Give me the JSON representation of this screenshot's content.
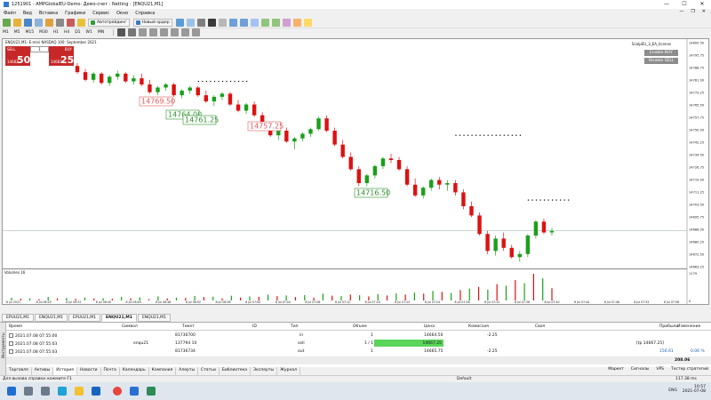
{
  "window": {
    "title": "1251901 - AMPGlobalEU-Demo: Демо-счет - Netting - [ENQU21,M1]",
    "controls": [
      "—",
      "☐",
      "✕"
    ]
  },
  "menu": [
    "Файл",
    "Вид",
    "Вставка",
    "Графики",
    "Сервис",
    "Окно",
    "Справка"
  ],
  "menu_mdi": [
    "—",
    "❐",
    "✕"
  ],
  "toolbar": {
    "autotrading_label": "Автотрейдинг",
    "new_order_label": "Новый ордер"
  },
  "timeframes": [
    "M1",
    "M5",
    "M15",
    "M30",
    "H1",
    "H4",
    "D1",
    "W1",
    "MN"
  ],
  "active_timeframe": "M1",
  "chart": {
    "symbol_header": "ENQU21,M1: E-mini NASDAQ 100: September 2021",
    "one_click": {
      "sell_label": "SELL",
      "buy_label": "BUY",
      "lot": "1",
      "sell_price_small": "14682",
      "sell_price_big": "50",
      "buy_price_small": "14683",
      "buy_price_big": "25"
    },
    "ea": {
      "name": "ScalpEU_3_EA_license",
      "enable_buy": "Enable BUY",
      "disable_sell": "Disable SELL"
    },
    "trade_labels": [
      {
        "text": "14769.50",
        "kind": "sell"
      },
      {
        "text": "14764.00",
        "kind": "buy"
      },
      {
        "text": "14761.25",
        "kind": "buy"
      },
      {
        "text": "14757.25",
        "kind": "sell"
      },
      {
        "text": "14716.50",
        "kind": "buy"
      }
    ],
    "volume_label": "Volumes 16",
    "volume_axis_top": "1179",
    "volume_axis_bottom": "0",
    "colors": {
      "up": "#1aa01a",
      "down": "#dd1111",
      "dots": "#000000"
    }
  },
  "chart_data": {
    "type": "candlestick",
    "series_name": "ENQU21",
    "ylim": [
      14663.25,
      14800.5
    ],
    "y_ticks": [
      "14800.50",
      "14795.75",
      "14788.75",
      "14781.00",
      "14773.25",
      "14765.50",
      "14757.75",
      "14750.00",
      "14742.25",
      "14734.50",
      "14726.75",
      "14719.00",
      "14711.25",
      "14703.50",
      "14695.75",
      "14688.00",
      "14680.25",
      "14672.50",
      "14663.25"
    ],
    "x_ticks": [
      "8 Jul 2021",
      "8 Jul 06:29",
      "8 Jul 06:32",
      "8 Jul 06:40",
      "8 Jul 06:46",
      "8 Jul 06:48",
      "8 Jul 06:52",
      "8 Jul 06:56",
      "8 Jul 07:00",
      "8 Jul 07:04",
      "8 Jul 07:08",
      "8 Jul 07:12",
      "8 Jul 07:16",
      "8 Jul 07:20",
      "8 Jul 07:24",
      "8 Jul 07:28",
      "8 Jul 07:32",
      "8 Jul 07:36",
      "8 Jul 07:40",
      "8 Jul 07:44",
      "8 Jul 07:48",
      "8 Jul 07:52",
      "8 Jul 07:56"
    ],
    "ohlc": [
      [
        14790,
        14792,
        14785,
        14786
      ],
      [
        14786,
        14788,
        14780,
        14781
      ],
      [
        14781,
        14786,
        14779,
        14785
      ],
      [
        14785,
        14786,
        14778,
        14779
      ],
      [
        14779,
        14784,
        14777,
        14783
      ],
      [
        14783,
        14787,
        14781,
        14785
      ],
      [
        14785,
        14786,
        14779,
        14780
      ],
      [
        14780,
        14784,
        14778,
        14782
      ],
      [
        14782,
        14785,
        14777,
        14778
      ],
      [
        14778,
        14781,
        14772,
        14773
      ],
      [
        14773,
        14777,
        14771,
        14776
      ],
      [
        14776,
        14779,
        14774,
        14778
      ],
      [
        14778,
        14779,
        14770,
        14771
      ],
      [
        14771,
        14775,
        14769,
        14774
      ],
      [
        14774,
        14777,
        14772,
        14776
      ],
      [
        14776,
        14777,
        14770,
        14771
      ],
      [
        14771,
        14774,
        14766,
        14767
      ],
      [
        14767,
        14771,
        14764,
        14770
      ],
      [
        14770,
        14773,
        14768,
        14772
      ],
      [
        14772,
        14773,
        14764,
        14765
      ],
      [
        14765,
        14768,
        14760,
        14761
      ],
      [
        14761,
        14766,
        14759,
        14765
      ],
      [
        14765,
        14767,
        14757,
        14758
      ],
      [
        14758,
        14760,
        14750,
        14751
      ],
      [
        14751,
        14753,
        14744,
        14745
      ],
      [
        14745,
        14749,
        14742,
        14748
      ],
      [
        14748,
        14750,
        14740,
        14741
      ],
      [
        14741,
        14744,
        14736,
        14743
      ],
      [
        14743,
        14747,
        14741,
        14746
      ],
      [
        14746,
        14750,
        14744,
        14749
      ],
      [
        14749,
        14757,
        14748,
        14756
      ],
      [
        14756,
        14758,
        14747,
        14748
      ],
      [
        14748,
        14750,
        14738,
        14739
      ],
      [
        14739,
        14742,
        14730,
        14731
      ],
      [
        14731,
        14734,
        14722,
        14723
      ],
      [
        14723,
        14725,
        14712,
        14714
      ],
      [
        14714,
        14720,
        14712,
        14719
      ],
      [
        14719,
        14726,
        14717,
        14725
      ],
      [
        14725,
        14731,
        14723,
        14730
      ],
      [
        14730,
        14733,
        14727,
        14729
      ],
      [
        14729,
        14731,
        14722,
        14723
      ],
      [
        14723,
        14725,
        14712,
        14713
      ],
      [
        14713,
        14717,
        14705,
        14706
      ],
      [
        14706,
        14712,
        14704,
        14711
      ],
      [
        14711,
        14717,
        14709,
        14716
      ],
      [
        14716,
        14718,
        14710,
        14713
      ],
      [
        14713,
        14716,
        14709,
        14714
      ],
      [
        14714,
        14716,
        14706,
        14708
      ],
      [
        14708,
        14710,
        14697,
        14699
      ],
      [
        14699,
        14702,
        14692,
        14693
      ],
      [
        14693,
        14695,
        14680,
        14681
      ],
      [
        14681,
        14683,
        14668,
        14670
      ],
      [
        14670,
        14680,
        14667,
        14678
      ],
      [
        14678,
        14682,
        14670,
        14672
      ],
      [
        14672,
        14674,
        14665,
        14666
      ],
      [
        14666,
        14670,
        14663,
        14668
      ],
      [
        14668,
        14681,
        14666,
        14680
      ],
      [
        14680,
        14690,
        14678,
        14689
      ],
      [
        14689,
        14691,
        14681,
        14682
      ],
      [
        14682,
        14685,
        14680,
        14683
      ]
    ],
    "volumes": [
      120,
      80,
      95,
      60,
      150,
      90,
      110,
      70,
      130,
      85,
      100,
      75,
      160,
      95,
      140,
      60,
      180,
      90,
      120,
      110,
      200,
      150,
      170,
      90,
      210,
      130,
      180,
      160,
      260,
      190,
      220,
      150,
      240,
      120,
      300,
      210,
      190,
      260,
      230,
      180,
      280,
      220,
      310,
      260,
      350,
      300,
      420,
      380,
      330,
      460,
      520,
      600,
      480,
      720,
      650,
      900,
      760,
      1179,
      980,
      540
    ],
    "dot_levels": [
      {
        "from": 30,
        "to": 42,
        "value": 14780
      },
      {
        "from": 94,
        "to": 110,
        "value": 14745
      },
      {
        "from": 112,
        "to": 122,
        "value": 14703
      }
    ]
  },
  "chart_tabs": [
    "EPUU21,M1",
    "ENQU21,M1",
    "EPUU21,M1",
    "ENQU21,M1",
    "ENQU21,M1"
  ],
  "active_chart_tab": 3,
  "toolbox": {
    "side_label": "Инструменты",
    "headers": {
      "time": "Время",
      "symbol": "Символ",
      "ticket": "Тикет",
      "id": "ID",
      "type": "Тип",
      "volume": "Объем",
      "price": "Цена",
      "commission": "Комиссия",
      "swap": "Своп",
      "profit": "Прибыль",
      "change": "Изменение"
    },
    "rows": [
      {
        "time": "2021.07.08 07:55:00",
        "symbol": "",
        "ticket": "81736700",
        "id": "",
        "type": "in",
        "volume": "1",
        "price": "14664.50",
        "commission": "-2.25",
        "swap": "",
        "profit": "",
        "change": ""
      },
      {
        "time": "2021.07.08 07:55:03",
        "symbol": "enqu21",
        "ticket": "137794 10",
        "id": "",
        "type": "sell",
        "volume": "1 / 1",
        "price": "14667.25",
        "commission": "",
        "swap": "",
        "profit": "[tp 14667.25]",
        "change": ""
      },
      {
        "time": "2021.07.08 07:55:03",
        "symbol": "",
        "ticket": "81736734",
        "id": "",
        "type": "out",
        "volume": "1",
        "price": "14665.75",
        "commission": "-2.25",
        "swap": "",
        "profit": "156.61",
        "change": "0.06 %"
      }
    ],
    "balance_total": "208.06"
  },
  "bottom_tabs": [
    "Торговля",
    "Активы",
    "История",
    "Новости",
    "Почта",
    "Календарь",
    "Компания",
    "Алерты",
    "Статьи",
    "Библиотека",
    "Эксперты",
    "Журнал"
  ],
  "active_bottom_tab": 2,
  "bottom_right": [
    "Маркет",
    "Сигналы",
    "VPS",
    "Тестер стратегий"
  ],
  "statusbar": {
    "help": "Для вызова справки нажмите F1",
    "profile": "Default",
    "ping": "117.38 ms"
  },
  "taskbar": {
    "lang": "ENG",
    "time": "10:57",
    "date": "2021-07-08"
  }
}
